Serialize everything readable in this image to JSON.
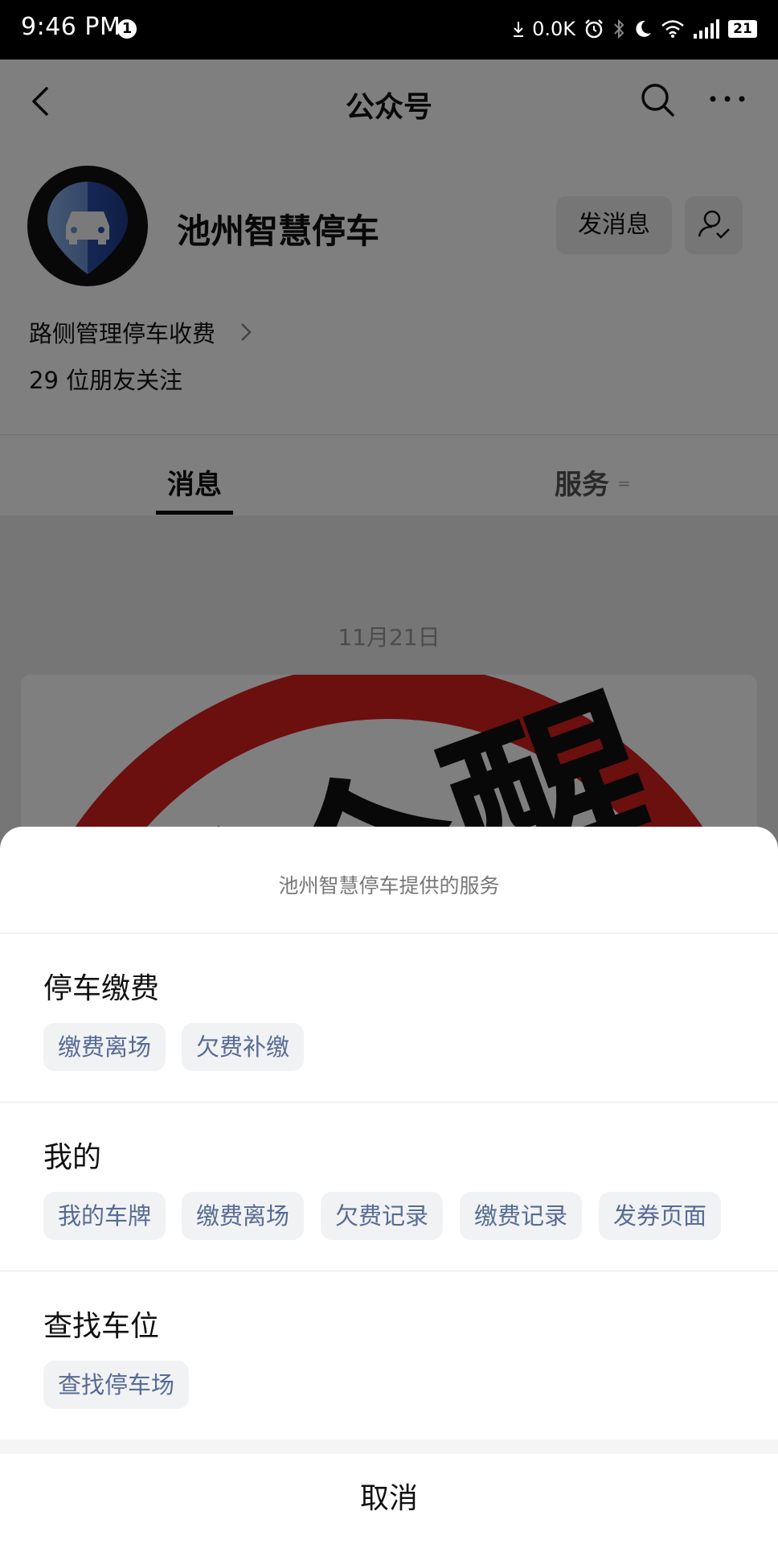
{
  "status_bar": {
    "time": "9:46 PM",
    "notification_count": "1",
    "net_speed": "0.0K",
    "battery": "21"
  },
  "navbar": {
    "title": "公众号"
  },
  "profile": {
    "name": "池州智慧停车",
    "send_message_label": "发消息",
    "description": "路侧管理停车收费",
    "followers": "29 位朋友关注"
  },
  "tabs": {
    "messages": "消息",
    "services": "服务",
    "services_mark": "="
  },
  "feed": {
    "date": "11月21日",
    "article_text": "提个醒"
  },
  "sheet": {
    "title": "池州智慧停车提供的服务",
    "sections": [
      {
        "title": "停车缴费",
        "items": [
          "缴费离场",
          "欠费补缴"
        ]
      },
      {
        "title": "我的",
        "items": [
          "我的车牌",
          "缴费离场",
          "欠费记录",
          "缴费记录",
          "发券页面"
        ]
      },
      {
        "title": "查找车位",
        "items": [
          "查找停车场"
        ]
      }
    ],
    "cancel_label": "取消"
  },
  "colors": {
    "link_blue": "#576b95",
    "chip_bg": "#f1f2f4",
    "warning_red": "#d61f1f",
    "overlay": "rgba(0,0,0,0.5)"
  }
}
